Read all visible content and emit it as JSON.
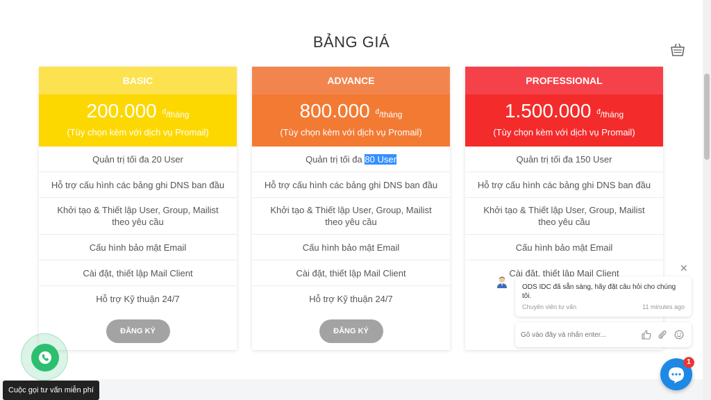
{
  "page": {
    "title": "BẢNG GIÁ"
  },
  "cards": [
    {
      "name": "BASIC",
      "price": "200.000",
      "unit_sup": "đ",
      "unit": "/tháng",
      "note": "(Tùy chọn kèm với dịch vụ Promail)",
      "features": [
        "Quản trị tối đa 20 User",
        "Hỗ trợ cấu hình các bảng ghi DNS ban đầu",
        "Khởi tạo & Thiết lập User, Group, Mailist theo yêu cầu",
        "Cấu hình bảo mật Email",
        "Cài đặt, thiết lập Mail Client",
        "Hỗ trợ Kỹ thuận 24/7"
      ],
      "button": "ĐĂNG KÝ",
      "colors": {
        "head": "#fde24f",
        "price": "#fdd800"
      }
    },
    {
      "name": "ADVANCE",
      "price": "800.000",
      "unit_sup": "đ",
      "unit": "/tháng",
      "note": "(Tùy chọn kèm với dịch vụ Promail)",
      "features_first_prefix": "Quản trị tối đa ",
      "features_first_selected": "80 User",
      "features": [
        "Hỗ trợ cấu hình các bảng ghi DNS ban đầu",
        "Khởi tạo & Thiết lập User, Group, Mailist theo yêu cầu",
        "Cấu hình bảo mật Email",
        "Cài đặt, thiết lập Mail Client",
        "Hỗ trợ Kỹ thuận 24/7"
      ],
      "button": "ĐĂNG KÝ",
      "colors": {
        "head": "#f2854e",
        "price": "#f37a33"
      }
    },
    {
      "name": "PROFESSIONAL",
      "price": "1.500.000",
      "unit_sup": "đ",
      "unit": "/tháng",
      "note": "(Tùy chọn kèm với dịch vụ Promail)",
      "features": [
        "Quản trị tối đa 150 User",
        "Hỗ trợ cấu hình các bảng ghi DNS ban đầu",
        "Khởi tạo & Thiết lập User, Group, Mailist theo yêu cầu",
        "Cấu hình bảo mật Email",
        "Cài đặt, thiết lập Mail Client"
      ],
      "colors": {
        "head": "#f5424a",
        "price": "#f42b2b"
      }
    }
  ],
  "call": {
    "label": "Cuộc gọi tư vấn miễn phí",
    "icon": "phone-icon"
  },
  "chat": {
    "message": "ODS IDC đã sẵn sàng, hãy đặt câu hỏi cho chúng tôi.",
    "agent": "Chuyên viên tư vấn",
    "time": "11 minutes ago",
    "input_placeholder": "Gõ vào đây và nhấn enter...",
    "badge": "1"
  }
}
